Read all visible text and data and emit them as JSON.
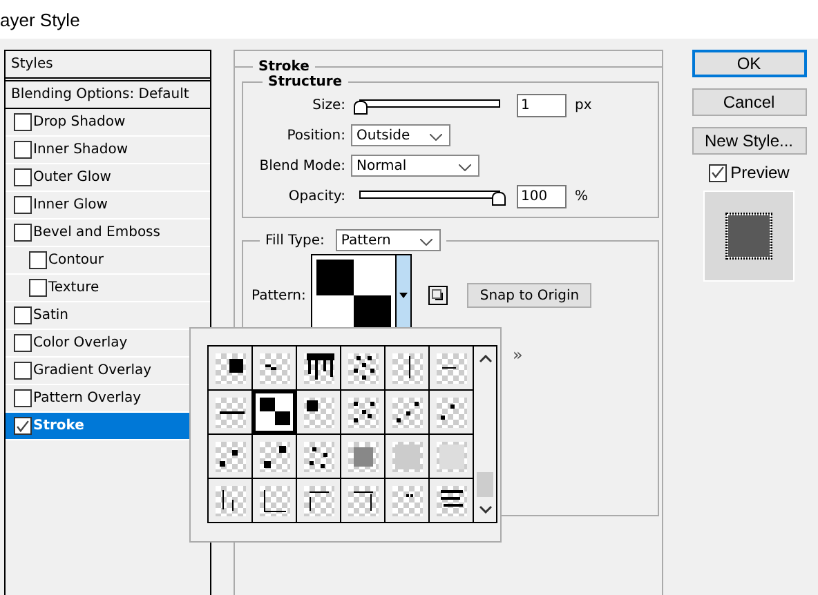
{
  "window": {
    "title": "ayer Style"
  },
  "styles_panel": {
    "header": "Styles",
    "blending": "Blending Options: Default",
    "items": [
      {
        "label": "Drop Shadow",
        "checked": false,
        "selected": false
      },
      {
        "label": "Inner Shadow",
        "checked": false,
        "selected": false
      },
      {
        "label": "Outer Glow",
        "checked": false,
        "selected": false
      },
      {
        "label": "Inner Glow",
        "checked": false,
        "selected": false
      },
      {
        "label": "Bevel and Emboss",
        "checked": false,
        "selected": false,
        "children": [
          {
            "label": "Contour",
            "checked": false,
            "selected": false
          },
          {
            "label": "Texture",
            "checked": false,
            "selected": false
          }
        ]
      },
      {
        "label": "Satin",
        "checked": false,
        "selected": false
      },
      {
        "label": "Color Overlay",
        "checked": false,
        "selected": false
      },
      {
        "label": "Gradient Overlay",
        "checked": false,
        "selected": false
      },
      {
        "label": "Pattern Overlay",
        "checked": false,
        "selected": false
      },
      {
        "label": "Stroke",
        "checked": true,
        "selected": true
      }
    ]
  },
  "stroke": {
    "title": "Stroke",
    "structure": {
      "title": "Structure",
      "size": {
        "label": "Size:",
        "level": 0.0,
        "value": "1",
        "unit": "px"
      },
      "position": {
        "label": "Position:",
        "value": "Outside"
      },
      "blend_mode": {
        "label": "Blend Mode:",
        "value": "Normal"
      },
      "opacity": {
        "label": "Opacity:",
        "level": 1.0,
        "value": "100",
        "unit": "%"
      }
    },
    "fill_type": {
      "label": "Fill Type:",
      "value": "Pattern"
    },
    "pattern": {
      "label": "Pattern:",
      "snap_button": "Snap to Origin"
    }
  },
  "pattern_picker": {
    "menu": "»",
    "tiles": [
      {
        "selected": false
      },
      {
        "selected": false
      },
      {
        "selected": false
      },
      {
        "selected": false
      },
      {
        "selected": false
      },
      {
        "selected": false
      },
      {
        "selected": false
      },
      {
        "selected": true
      },
      {
        "selected": false
      },
      {
        "selected": false
      },
      {
        "selected": false
      },
      {
        "selected": false
      },
      {
        "selected": false
      },
      {
        "selected": false
      },
      {
        "selected": false
      },
      {
        "selected": false
      },
      {
        "selected": false
      },
      {
        "selected": false
      },
      {
        "selected": false
      },
      {
        "selected": false
      },
      {
        "selected": false
      },
      {
        "selected": false
      },
      {
        "selected": false
      },
      {
        "selected": false
      }
    ]
  },
  "buttons": [
    {
      "label": "OK",
      "default": true
    },
    {
      "label": "Cancel",
      "default": false
    },
    {
      "label": "New Style...",
      "default": false
    }
  ],
  "preview": {
    "label": "Preview",
    "checked": true
  }
}
